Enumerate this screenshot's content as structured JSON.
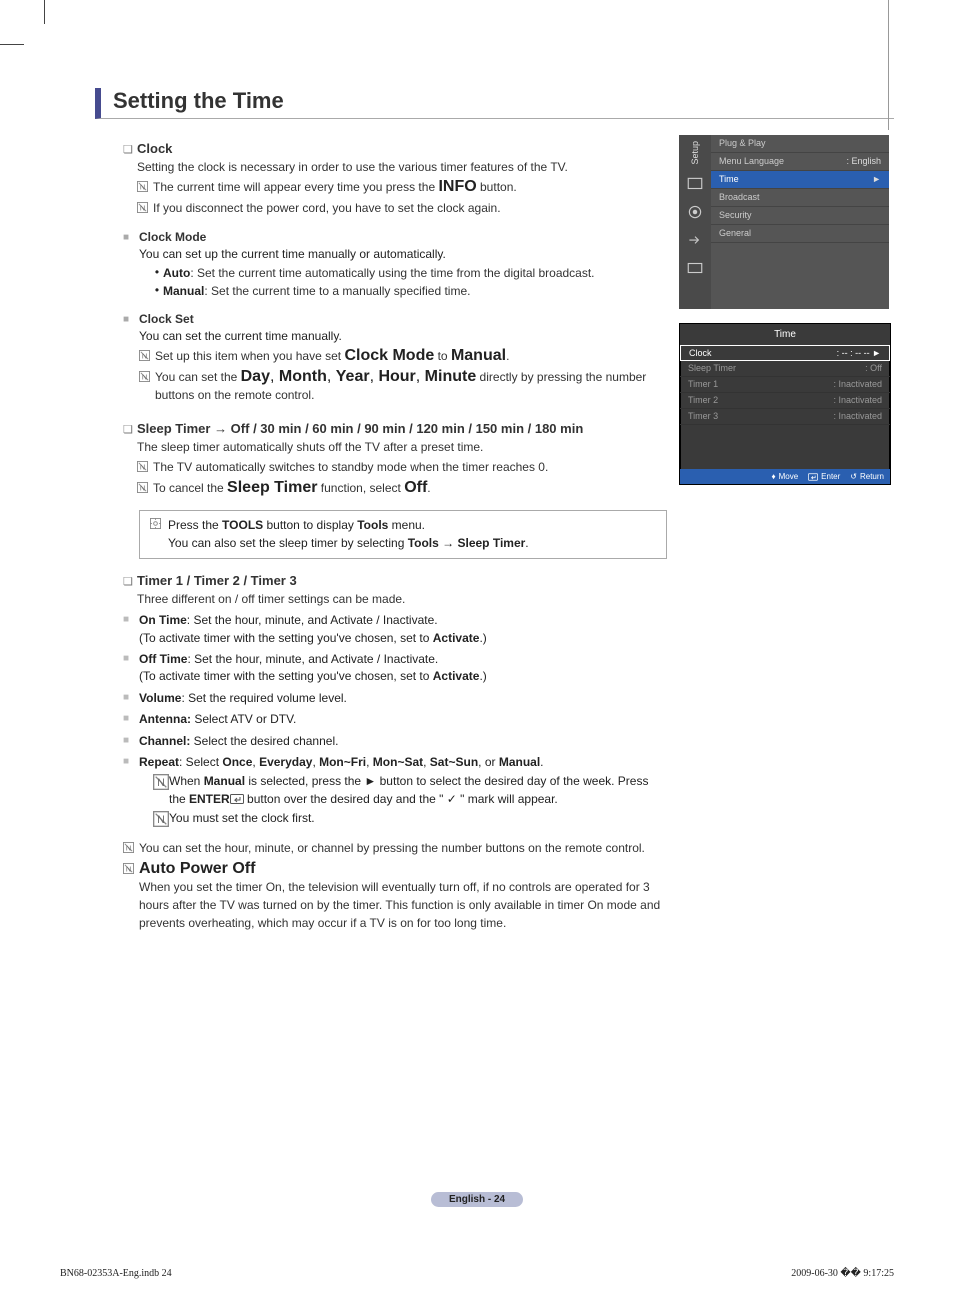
{
  "title": "Setting the Time",
  "sections": {
    "clock": {
      "heading": "Clock",
      "desc": "Setting the clock is necessary in order to use the various timer features of the TV.",
      "note1a": "The current time will appear every time you press the ",
      "note1b": "INFO",
      "note1c": " button.",
      "note2": "If you disconnect the power cord, you have to set the clock again.",
      "mode": {
        "heading": "Clock Mode",
        "desc": "You can set up the current time manually or automatically.",
        "auto_l": "Auto",
        "auto_t": ": Set the current time automatically using the time from the digital broadcast.",
        "manual_l": "Manual",
        "manual_t": ": Set the current time to a manually specified time."
      },
      "set": {
        "heading": "Clock Set",
        "desc": "You can set the current time manually.",
        "n1a": "Set up this item when you have set ",
        "n1b": "Clock Mode",
        "n1c": " to ",
        "n1d": "Manual",
        "n1e": ".",
        "n2a": "You can set the ",
        "n2b": "Day",
        "n2c": "Month",
        "n2d": "Year",
        "n2e": "Hour",
        "n2f": "Minute",
        "n2g": " directly by pressing the number buttons on the remote control."
      }
    },
    "sleep": {
      "heading": "Sleep Timer → Off / 30 min / 60 min / 90 min / 120 min / 150 min / 180 min",
      "desc": "The sleep timer automatically shuts off the TV after a preset time.",
      "n1": "The TV automatically switches to standby mode when the timer reaches 0.",
      "n2a": "To cancel the ",
      "n2b": "Sleep Timer",
      "n2c": " function, select ",
      "n2d": "Off",
      "n2e": ".",
      "tool1a": "Press the ",
      "tool1b": "TOOLS",
      "tool1c": " button to display ",
      "tool1d": "Tools",
      "tool1e": " menu.",
      "tool2a": "You can also set the sleep timer by selecting ",
      "tool2b": "Tools → Sleep Timer",
      "tool2c": "."
    },
    "timer": {
      "heading": "Timer 1 / Timer 2 / Timer 3",
      "desc": "Three different on / off timer settings can be made.",
      "on_h": "On Time",
      "on_t": ": Set the hour, minute, and Activate / Inactivate.",
      "on_sub_a": "(To activate timer with the setting you've chosen, set to ",
      "on_sub_b": "Activate",
      "on_sub_c": ".)",
      "off_h": "Off Time",
      "off_t": ": Set the hour, minute, and Activate / Inactivate.",
      "vol_h": "Volume",
      "vol_t": ": Set the required volume level.",
      "ant_h": "Antenna:",
      "ant_t": " Select ATV or DTV.",
      "ch_h": "Channel:",
      "ch_t": " Select the desired channel.",
      "rep_h": "Repeat",
      "rep_ta": ": Select ",
      "rep_o1": "Once",
      "rep_o2": "Everyday",
      "rep_o3": "Mon~Fri",
      "rep_o4": "Mon~Sat",
      "rep_o5": "Sat~Sun",
      "rep_o6": "Manual",
      "rep_tb": ".",
      "rep_n1a": "When ",
      "rep_n1b": "Manual",
      "rep_n1c": " is selected, press the ► button to select the desired day of the week. Press the ",
      "rep_n1d": "ENTER",
      "rep_n1e": " button over the desired day and the \" ✓ \" mark will appear.",
      "rep_n2": "You must set the clock first.",
      "bottom_n1": "You can set the hour, minute, or channel by pressing the number buttons on the remote control.",
      "apo_h": "Auto Power Off",
      "apo_t": "When you set the timer On, the television will eventually turn off, if no controls are operated for 3 hours after the TV was turned on by the timer. This function is only available in timer On mode and prevents overheating, which may occur if a TV is on for too long time."
    }
  },
  "osd1": {
    "side_label": "Setup",
    "items": [
      {
        "l": "Plug & Play",
        "r": ""
      },
      {
        "l": "Menu Language",
        "r": ": English"
      },
      {
        "l": "Time",
        "r": "►",
        "sel": true
      },
      {
        "l": "Broadcast",
        "r": ""
      },
      {
        "l": "Security",
        "r": ""
      },
      {
        "l": "General",
        "r": ""
      }
    ]
  },
  "osd2": {
    "title": "Time",
    "rows": [
      {
        "l": "Clock",
        "r": ": -- : -- --    ►",
        "sel": true
      },
      {
        "l": "Sleep Timer",
        "r": ": Off"
      },
      {
        "l": "Timer 1",
        "r": ": Inactivated"
      },
      {
        "l": "Timer 2",
        "r": ": Inactivated"
      },
      {
        "l": "Timer 3",
        "r": ": Inactivated"
      }
    ],
    "footer": {
      "move": "Move",
      "enter": "Enter",
      "return": "Return"
    }
  },
  "pagefoot": {
    "lang": "English - 24",
    "file": "BN68-02353A-Eng.indb   24",
    "date": "2009-06-30   �� 9:17:25"
  }
}
